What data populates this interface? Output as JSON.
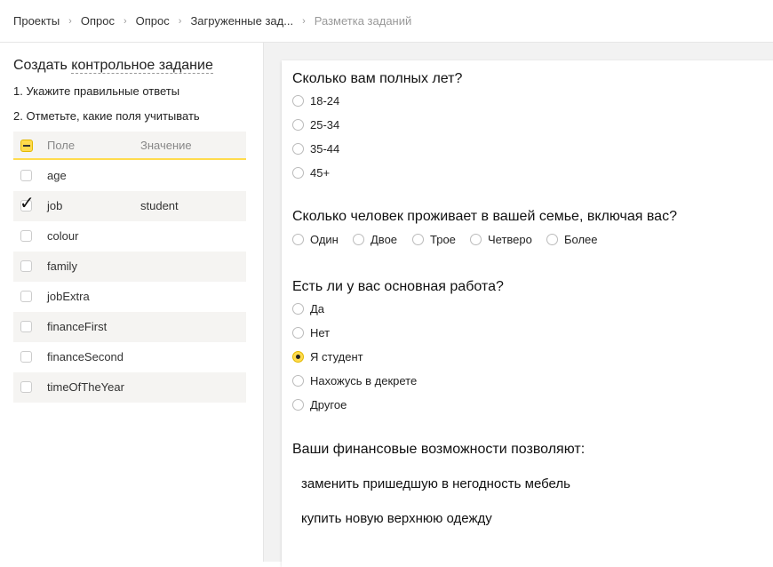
{
  "breadcrumbs": [
    "Проекты",
    "Опрос",
    "Опрос",
    "Загруженные зад...",
    "Разметка заданий"
  ],
  "left": {
    "title_prefix": "Создать",
    "title_link": "контрольное задание",
    "step1": "1. Укажите правильные ответы",
    "step2": "2. Отметьте, какие поля учитывать",
    "col_field": "Поле",
    "col_value": "Значение",
    "rows": [
      {
        "name": "age",
        "value": "",
        "checked": false
      },
      {
        "name": "job",
        "value": "student",
        "checked": true
      },
      {
        "name": "colour",
        "value": "",
        "checked": false
      },
      {
        "name": "family",
        "value": "",
        "checked": false
      },
      {
        "name": "jobExtra",
        "value": "",
        "checked": false
      },
      {
        "name": "financeFirst",
        "value": "",
        "checked": false
      },
      {
        "name": "financeSecond",
        "value": "",
        "checked": false
      },
      {
        "name": "timeOfTheYear",
        "value": "",
        "checked": false
      }
    ]
  },
  "questions": {
    "q1": {
      "text": "Сколько вам полных лет?",
      "options": [
        "18-24",
        "25-34",
        "35-44",
        "45+"
      ]
    },
    "q2": {
      "text": "Сколько человек проживает в вашей семье, включая вас?",
      "options": [
        "Один",
        "Двое",
        "Трое",
        "Четверо",
        "Более"
      ]
    },
    "q3": {
      "text": "Есть ли у вас основная работа?",
      "options": [
        "Да",
        "Нет",
        "Я студент",
        "Нахожусь в декрете",
        "Другое"
      ],
      "selected": "Я студент"
    },
    "q4": {
      "text": "Ваши финансовые возможности позволяют:",
      "items": [
        "заменить пришедшую в негодность мебель",
        "купить новую верхнюю одежду"
      ]
    }
  },
  "colors": {
    "accent": "#ffdb4d",
    "stripe": "#f5f4f2"
  }
}
